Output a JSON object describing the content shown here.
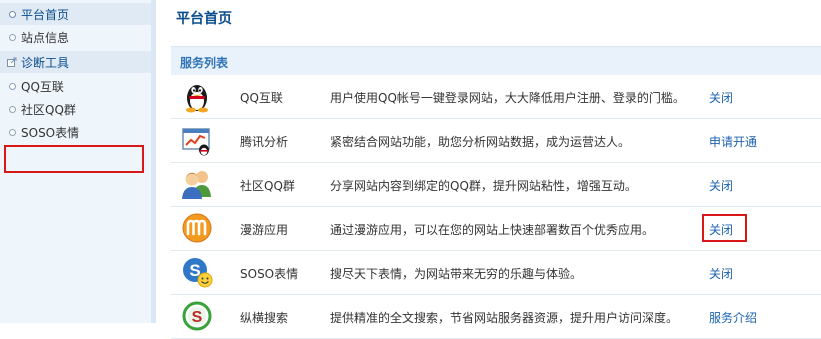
{
  "sidebar": {
    "items": [
      {
        "label": "平台首页",
        "type": "section",
        "icon": "circle-bullet"
      },
      {
        "label": "站点信息",
        "type": "item",
        "icon": "circle-bullet"
      },
      {
        "label": "诊断工具",
        "type": "section",
        "icon": "external-link-icon"
      },
      {
        "label": "QQ互联",
        "type": "item",
        "icon": "circle-bullet"
      },
      {
        "label": "社区QQ群",
        "type": "item",
        "icon": "circle-bullet"
      },
      {
        "label": "SOSO表情",
        "type": "item",
        "icon": "circle-bullet"
      }
    ]
  },
  "main": {
    "title": "平台首页",
    "panel_title": "服务列表",
    "services": [
      {
        "name": "QQ互联",
        "desc": "用户使用QQ帐号一键登录网站，大大降低用户注册、登录的门槛。",
        "action": "关闭",
        "icon": "qq-penguin-icon"
      },
      {
        "name": "腾讯分析",
        "desc": "紧密结合网站功能，助您分析网站数据，成为运营达人。",
        "action": "申请开通",
        "icon": "analytics-chart-icon"
      },
      {
        "name": "社区QQ群",
        "desc": "分享网站内容到绑定的QQ群，提升网站粘性，增强互动。",
        "action": "关闭",
        "icon": "user-group-icon"
      },
      {
        "name": "漫游应用",
        "desc": "通过漫游应用，可以在您的网站上快速部署数百个优秀应用。",
        "action": "关闭",
        "icon": "manyou-m-icon"
      },
      {
        "name": "SOSO表情",
        "desc": "搜尽天下表情，为网站带来无穷的乐趣与体验。",
        "action": "关闭",
        "icon": "soso-emoticon-icon"
      },
      {
        "name": "纵横搜索",
        "desc": "提供精准的全文搜索，节省网站服务器资源，提升用户访问深度。",
        "action": "服务介绍",
        "icon": "search-s-icon"
      }
    ]
  },
  "colors": {
    "accent": "#0a4d8c",
    "link": "#1d62b0",
    "sidebar_bg": "#eef5fb",
    "highlight_box": "#d81818"
  }
}
